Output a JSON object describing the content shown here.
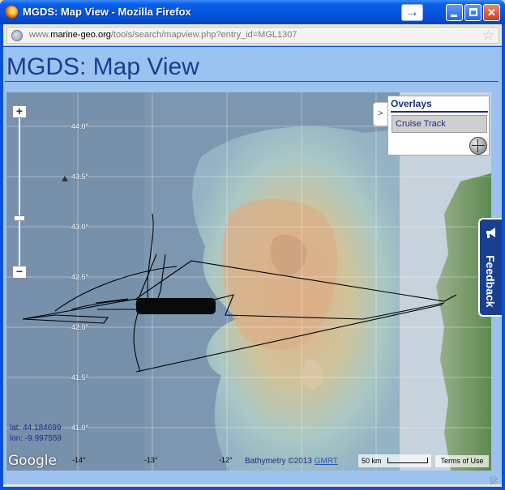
{
  "window": {
    "title": "MGDS: Map View - Mozilla Firefox",
    "arrow_glyph": "→"
  },
  "urlbar": {
    "prefix": "www.",
    "domain": "marine-geo.org",
    "path": "/tools/search/mapview.php?entry_id=MGL1307"
  },
  "page": {
    "title": "MGDS: Map View"
  },
  "map": {
    "lat_labels": [
      "44.0°",
      "43.5°",
      "43.0°",
      "42.5°",
      "42.0°",
      "41.5°",
      "41.0°"
    ],
    "lon_labels": [
      "-14°",
      "-13°",
      "-12°"
    ],
    "zoom_in": "+",
    "zoom_out": "−",
    "overlays_title": "Overlays",
    "overlay_item": "Cruise Track",
    "overlay_toggle": ">",
    "feedback_label": "Feedback",
    "lat_readout": "lat: 44.184699",
    "lon_readout": "lon: -9.997559",
    "google_logo": "Google",
    "attribution_text": "Bathymetry ©2013",
    "attribution_link": "GMRT",
    "scale_label": "50 km",
    "terms": "Terms of Use",
    "colors": {
      "ocean": "#7a96b0",
      "shelf_high": "#e0b08a",
      "track": "#000000",
      "land": "#5d8a4e"
    }
  }
}
